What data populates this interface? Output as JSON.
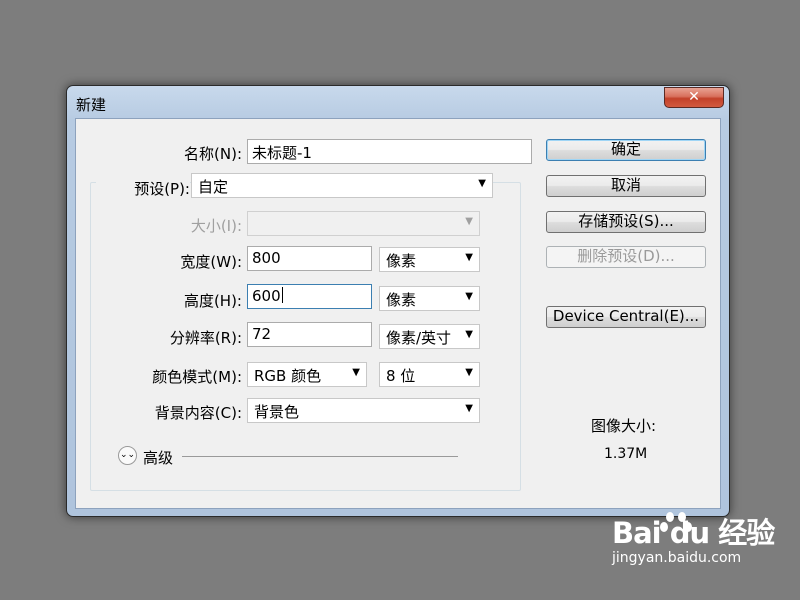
{
  "dialog": {
    "title": "新建",
    "close_label": "✕",
    "name_label": "名称(N):",
    "name_value": "未标题-1",
    "preset_label": "预设(P):",
    "preset_value": "自定",
    "size_label": "大小(I):",
    "size_value": "",
    "width_label": "宽度(W):",
    "width_value": "800",
    "width_unit": "像素",
    "height_label": "高度(H):",
    "height_value": "600",
    "height_unit": "像素",
    "resolution_label": "分辨率(R):",
    "resolution_value": "72",
    "resolution_unit": "像素/英寸",
    "color_mode_label": "颜色模式(M):",
    "color_mode_value": "RGB 颜色",
    "bit_depth_value": "8 位",
    "background_label": "背景内容(C):",
    "background_value": "背景色",
    "advanced_label": "高级",
    "ok_label": "确定",
    "cancel_label": "取消",
    "save_preset_label": "存储预设(S)...",
    "delete_preset_label": "删除预设(D)...",
    "device_central_label": "Device Central(E)...",
    "image_size_label": "图像大小:",
    "image_size_value": "1.37M"
  },
  "watermark": {
    "logo": "Bai du 经验",
    "url": "jingyan.baidu.com"
  },
  "icons": {
    "dropdown": "▼",
    "expand": "⌄⌄"
  }
}
